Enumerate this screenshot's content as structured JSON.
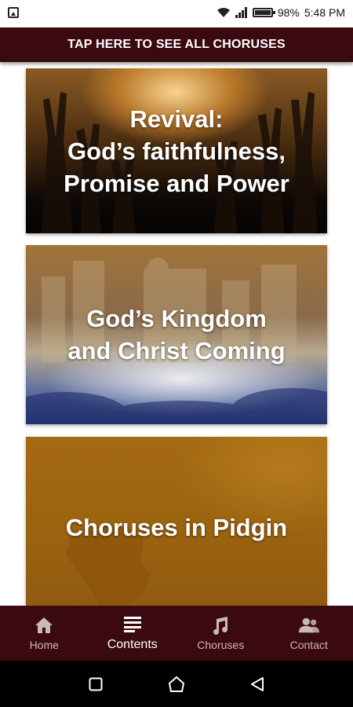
{
  "status_bar": {
    "battery_text": "98%",
    "time": "5:48 PM",
    "icons": [
      "image-icon",
      "wifi-icon",
      "signal-icon",
      "battery-icon"
    ]
  },
  "top_banner": {
    "label": "TAP HERE TO SEE ALL CHORUSES"
  },
  "cards": [
    {
      "title": "Revival:\nGod’s faithfulness,\nPromise and Power"
    },
    {
      "title": "God’s Kingdom\nand Christ Coming"
    },
    {
      "title": "Choruses in Pidgin"
    }
  ],
  "bottom_nav": {
    "items": [
      {
        "label": "Home",
        "icon": "home-icon",
        "active": false
      },
      {
        "label": "Contents",
        "icon": "list-icon",
        "active": true
      },
      {
        "label": "Choruses",
        "icon": "music-note-icon",
        "active": false
      },
      {
        "label": "Contact",
        "icon": "people-icon",
        "active": false
      }
    ]
  },
  "system_nav": {
    "icons": [
      "recents-icon",
      "home-circle-icon",
      "back-icon"
    ]
  },
  "colors": {
    "banner_bg": "#3a0a10",
    "nav_bg": "#3a0a10",
    "nav_active": "#ffffff",
    "nav_inactive": "#c9b9bb"
  }
}
